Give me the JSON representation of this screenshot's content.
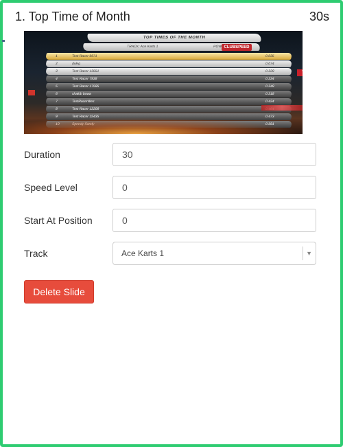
{
  "slide": {
    "title": "1. Top Time of Month",
    "duration_badge": "30s"
  },
  "preview": {
    "banner_title": "TOP TIMES OF THE MONTH",
    "track_label": "TRACK: Ace Karts 1",
    "powered_by": "POWERED BY",
    "logo_text": "CLUBSPEED",
    "sponsor_text": "TOTAL",
    "rows": [
      {
        "pos": "1",
        "name": "Test Racer 6971",
        "time": "0.035"
      },
      {
        "pos": "2",
        "name": "dvleg",
        "time": "0.074"
      },
      {
        "pos": "3",
        "name": "Test Racer 13551",
        "time": "0.229"
      },
      {
        "pos": "4",
        "name": "Test Racer 7938",
        "time": "0.234"
      },
      {
        "pos": "5",
        "name": "Test Racer 17595",
        "time": "0.249"
      },
      {
        "pos": "6",
        "name": "shakib bawa",
        "time": "0.318"
      },
      {
        "pos": "7",
        "name": "TestRacerWes",
        "time": "0.424"
      },
      {
        "pos": "8",
        "name": "Test Racer 12208",
        "time": "0.464"
      },
      {
        "pos": "9",
        "name": "Test Racer 15435",
        "time": "0.473"
      },
      {
        "pos": "10",
        "name": "Speedy Sandy",
        "time": "0.591"
      }
    ]
  },
  "form": {
    "duration": {
      "label": "Duration",
      "value": "30"
    },
    "speed_level": {
      "label": "Speed Level",
      "value": "0"
    },
    "start_position": {
      "label": "Start At Position",
      "value": "0"
    },
    "track": {
      "label": "Track",
      "value": "Ace Karts 1"
    }
  },
  "actions": {
    "delete_label": "Delete Slide"
  },
  "colors": {
    "border": "#2ecc71",
    "danger": "#e74c3c"
  }
}
